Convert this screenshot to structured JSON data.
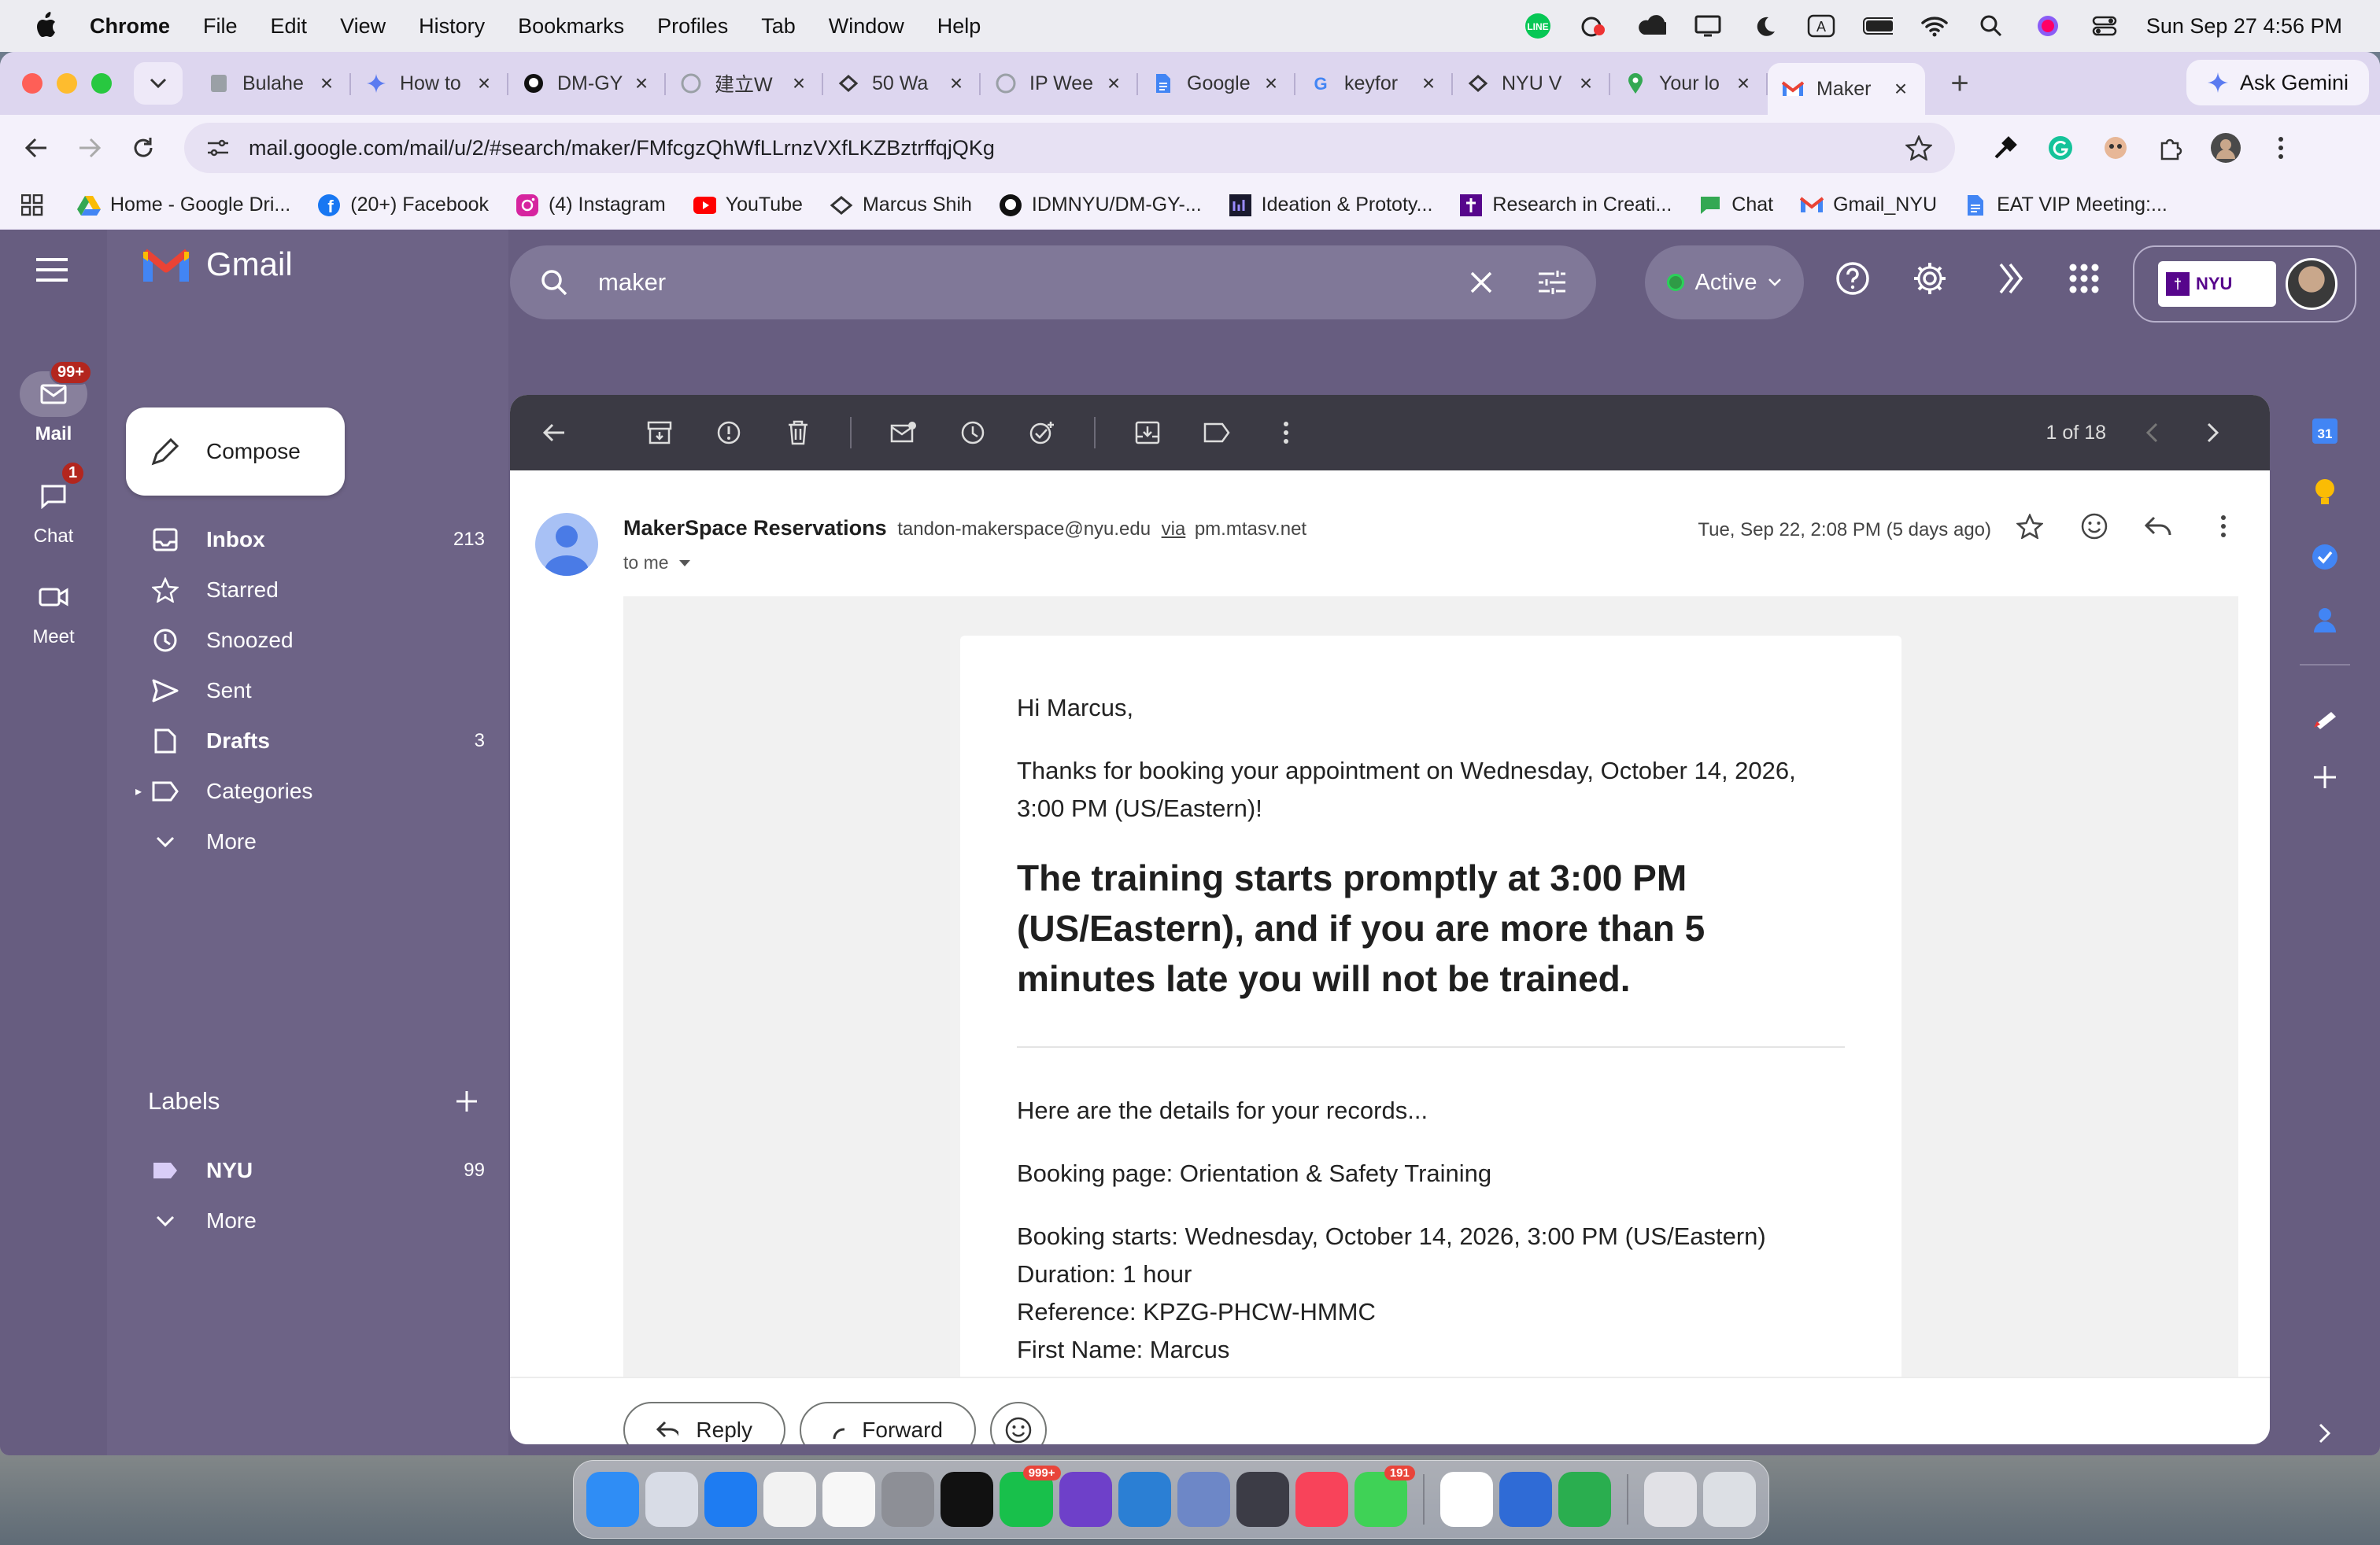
{
  "menubar": {
    "app_name": "Chrome",
    "items": [
      "File",
      "Edit",
      "View",
      "History",
      "Bookmarks",
      "Profiles",
      "Tab",
      "Window",
      "Help"
    ],
    "clock": "Sun Sep 27  4:56 PM"
  },
  "tabs": [
    {
      "title": "Bulahe",
      "icon": "page-icon"
    },
    {
      "title": "How to",
      "icon": "gemini-icon"
    },
    {
      "title": "DM-GY",
      "icon": "github-icon"
    },
    {
      "title": "建立W",
      "icon": "page-icon"
    },
    {
      "title": "50 Wa",
      "icon": "page-icon"
    },
    {
      "title": "IP Wee",
      "icon": "page-icon"
    },
    {
      "title": "Google",
      "icon": "docs-icon"
    },
    {
      "title": "keyfor",
      "icon": "google-icon"
    },
    {
      "title": "NYU V",
      "icon": "page-icon"
    },
    {
      "title": "Your lo",
      "icon": "maps-icon"
    },
    {
      "title": "Maker",
      "icon": "gmail-icon",
      "active": true
    }
  ],
  "ask_gemini": "Ask Gemini",
  "omnibox": {
    "url": "mail.google.com/mail/u/2/#search/maker/FMfcgzQhWfLLrnzVXfLKZBztrffqjQKg"
  },
  "bookmarks": [
    {
      "label": "Home - Google Dri...",
      "icon": "drive-icon"
    },
    {
      "label": "(20+) Facebook",
      "icon": "facebook-icon"
    },
    {
      "label": "(4) Instagram",
      "icon": "instagram-icon"
    },
    {
      "label": "YouTube",
      "icon": "youtube-icon"
    },
    {
      "label": "Marcus Shih",
      "icon": "page-icon"
    },
    {
      "label": "IDMNYU/DM-GY-...",
      "icon": "github-icon"
    },
    {
      "label": "Ideation & Prototy...",
      "icon": "page-icon"
    },
    {
      "label": "Research in Creati...",
      "icon": "page-icon"
    },
    {
      "label": "Chat",
      "icon": "chat-icon"
    },
    {
      "label": "Gmail_NYU",
      "icon": "gmail-icon"
    },
    {
      "label": "EAT VIP Meeting:...",
      "icon": "docs-icon"
    }
  ],
  "rail": {
    "mail": {
      "label": "Mail",
      "badge": "99+"
    },
    "chat": {
      "label": "Chat",
      "badge": "1"
    },
    "meet": {
      "label": "Meet"
    }
  },
  "gmail": {
    "logo_text": "Gmail",
    "compose": "Compose",
    "nav": [
      {
        "label": "Inbox",
        "count": "213",
        "bold": true,
        "icon": "inbox-icon"
      },
      {
        "label": "Starred",
        "count": "",
        "bold": false,
        "icon": "star-icon"
      },
      {
        "label": "Snoozed",
        "count": "",
        "bold": false,
        "icon": "clock-icon"
      },
      {
        "label": "Sent",
        "count": "",
        "bold": false,
        "icon": "send-icon"
      },
      {
        "label": "Drafts",
        "count": "3",
        "bold": true,
        "icon": "draft-icon"
      },
      {
        "label": "Categories",
        "count": "",
        "bold": false,
        "icon": "label-icon"
      },
      {
        "label": "More",
        "count": "",
        "bold": false,
        "icon": "chevron-down-icon"
      }
    ],
    "labels_title": "Labels",
    "labels": [
      {
        "label": "NYU",
        "count": "99"
      },
      {
        "label": "More",
        "count": ""
      }
    ],
    "search_query": "maker",
    "status": "Active",
    "pager": "1 of 18",
    "account_logo": "NYU"
  },
  "message": {
    "sender_name": "MakerSpace Reservations",
    "sender_email": "tandon-makerspace@nyu.edu",
    "via": "via",
    "via_domain": "pm.mtasv.net",
    "to": "to me",
    "date": "Tue, Sep 22, 2:08 PM (5 days ago)",
    "greeting": "Hi Marcus,",
    "intro": "Thanks for booking your appointment on Wednesday, October 14, 2026, 3:00 PM (US/Eastern)!",
    "headline": "The training starts promptly at 3:00 PM (US/Eastern), and if you are more than 5 minutes late you will not be trained.",
    "details_intro": "Here are the details for your records...",
    "booking_page": "Booking page: Orientation & Safety Training",
    "booking_starts": "Booking starts: Wednesday, October 14, 2026, 3:00 PM (US/Eastern)",
    "duration": "Duration: 1 hour",
    "reference": "Reference: KPZG-PHCW-HMMC",
    "first_name": "First Name: Marcus"
  },
  "reply_bar": {
    "reply": "Reply",
    "forward": "Forward"
  },
  "dock": {
    "apps": [
      {
        "name": "finder",
        "color": "#2f8df5"
      },
      {
        "name": "launchpad",
        "color": "#d8dce6"
      },
      {
        "name": "safari",
        "color": "#1e7cf2"
      },
      {
        "name": "chrome",
        "color": "#f2f2f2"
      },
      {
        "name": "photos",
        "color": "#f7f7f7"
      },
      {
        "name": "system-settings",
        "color": "#8d8f96"
      },
      {
        "name": "spotify",
        "color": "#111111"
      },
      {
        "name": "line",
        "color": "#18c04b",
        "badge": "999+"
      },
      {
        "name": "github-desktop",
        "color": "#6e40c9"
      },
      {
        "name": "vscode",
        "color": "#2b7fd4"
      },
      {
        "name": "preview",
        "color": "#6d87c7"
      },
      {
        "name": "obs",
        "color": "#3c3c46"
      },
      {
        "name": "music",
        "color": "#f8435a"
      },
      {
        "name": "messages",
        "color": "#3fd256",
        "badge": "191"
      },
      {
        "name": "slack",
        "color": "#ffffff"
      },
      {
        "name": "chatgpt",
        "color": "#2f6bd6"
      },
      {
        "name": "numbers",
        "color": "#2aae4f"
      },
      {
        "name": "downloads",
        "color": "#e1e1e6"
      },
      {
        "name": "trash",
        "color": "#dcdfe4"
      }
    ]
  }
}
